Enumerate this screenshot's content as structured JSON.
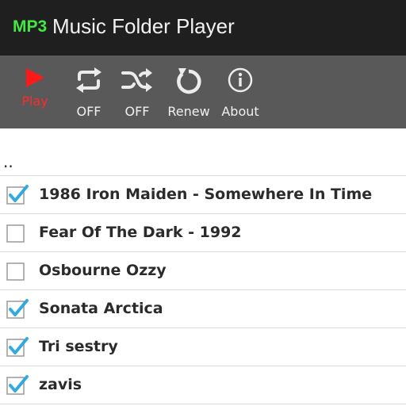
{
  "app": {
    "icon_text": "MP3",
    "title": "Music Folder Player"
  },
  "toolbar": {
    "play": {
      "label": "Play",
      "icon": "play-icon"
    },
    "repeat": {
      "label": "OFF",
      "icon": "repeat-icon"
    },
    "shuffle": {
      "label": "OFF",
      "icon": "shuffle-icon"
    },
    "renew": {
      "label": "Renew",
      "icon": "renew-icon"
    },
    "about": {
      "label": "About",
      "icon": "info-icon"
    }
  },
  "list": {
    "parent_label": "..",
    "items": [
      {
        "label": "1986 Iron Maiden - Somewhere In Time",
        "checked": true
      },
      {
        "label": "Fear Of The Dark - 1992",
        "checked": false
      },
      {
        "label": "Osbourne Ozzy",
        "checked": false
      },
      {
        "label": "Sonata Arctica",
        "checked": true
      },
      {
        "label": "Tri sestry",
        "checked": true
      },
      {
        "label": "zavis",
        "checked": true
      }
    ]
  },
  "colors": {
    "titlebar_bg": "#1f1f1f",
    "toolbar_bg": "#595959",
    "mp3_green": "#44e744",
    "play_red": "#ff1a1a",
    "check_blue": "#33aadd"
  }
}
